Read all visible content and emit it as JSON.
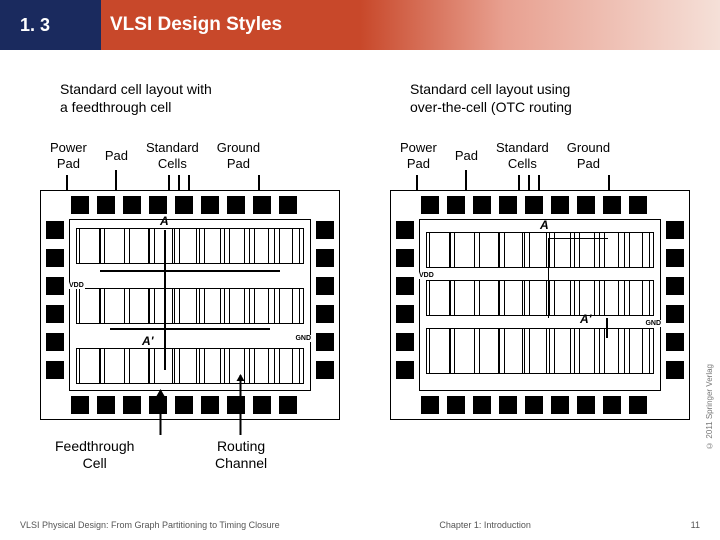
{
  "header": {
    "section_num": "1. 3",
    "title": "VLSI Design Styles"
  },
  "left": {
    "caption_l1": "Standard cell layout with",
    "caption_l2": "a feedthrough cell",
    "labels": {
      "power_pad_l1": "Power",
      "power_pad_l2": "Pad",
      "pad": "Pad",
      "std_l1": "Standard",
      "std_l2": "Cells",
      "gnd_l1": "Ground",
      "gnd_l2": "Pad"
    },
    "vdd": "VDD",
    "gnd": "GND",
    "A": "A",
    "Aprime": "A'",
    "under1_l1": "Feedthrough",
    "under1_l2": "Cell",
    "under2_l1": "Routing",
    "under2_l2": "Channel"
  },
  "right": {
    "caption_l1": "Standard cell layout using",
    "caption_l2": "over-the-cell (OTC routing",
    "labels": {
      "power_pad_l1": "Power",
      "power_pad_l2": "Pad",
      "pad": "Pad",
      "std_l1": "Standard",
      "std_l2": "Cells",
      "gnd_l1": "Ground",
      "gnd_l2": "Pad"
    },
    "vdd": "VDD",
    "gnd": "GND",
    "A": "A",
    "Aprime": "A'"
  },
  "footer": {
    "left": "VLSI Physical Design: From Graph Partitioning to Timing Closure",
    "center": "Chapter 1: Introduction",
    "right": "11"
  },
  "copyright": "© 2011 Springer Verlag"
}
